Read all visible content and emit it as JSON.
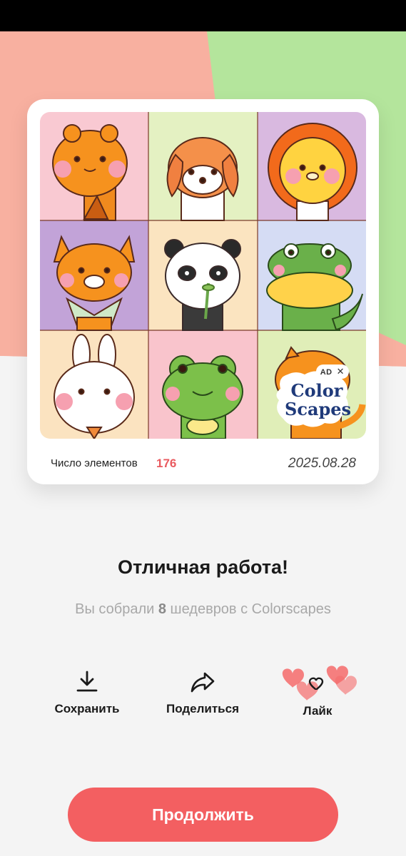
{
  "card": {
    "elements_label": "Число элементов",
    "elements_count": "176",
    "date": "2025.08.28",
    "ad": {
      "tag": "AD",
      "close": "✕",
      "brand_line1": "Color",
      "brand_line2": "Scapes"
    },
    "tiles": [
      "giraffe",
      "puppy",
      "lion",
      "fox",
      "panda",
      "crocodile",
      "bunny",
      "frog",
      "tiger"
    ]
  },
  "result": {
    "title": "Отличная работа!",
    "subtitle_prefix": "Вы собрали ",
    "subtitle_count": "8",
    "subtitle_suffix": " шедевров с Colorscapes"
  },
  "actions": {
    "save_label": "Сохранить",
    "share_label": "Поделиться",
    "like_label": "Лайк"
  },
  "continue_label": "Продолжить",
  "colors": {
    "accent": "#f35f61",
    "count": "#e95a5f",
    "bg_salmon": "#f8b0a0",
    "bg_green": "#b4e59c"
  }
}
